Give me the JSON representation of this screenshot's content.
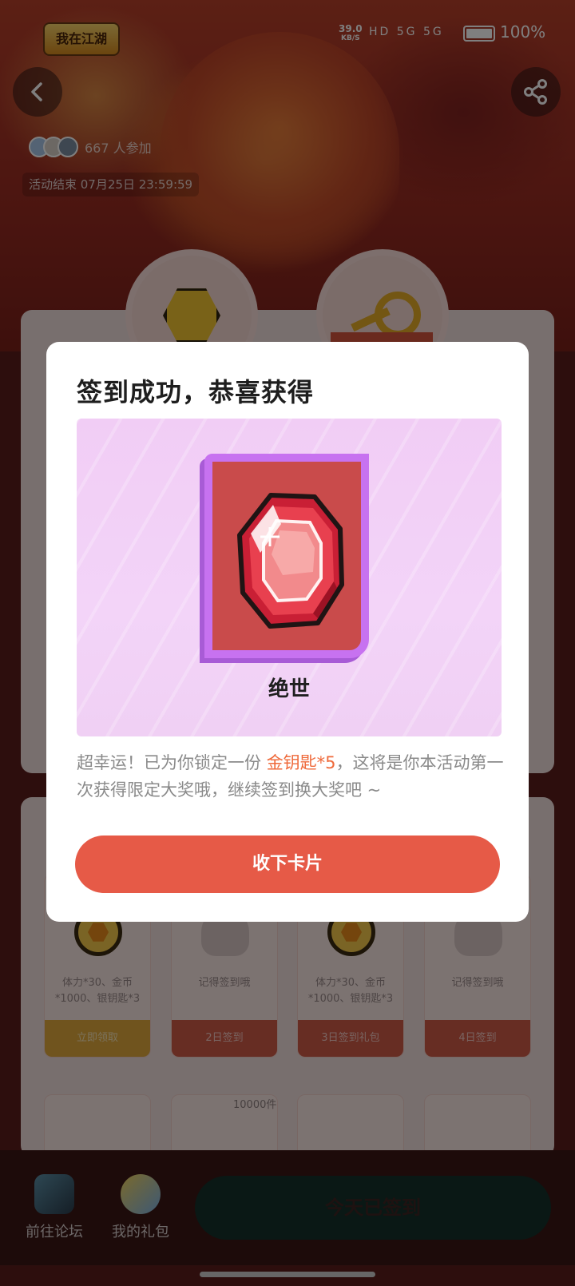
{
  "status_bar": {
    "net_speed": "39.0",
    "net_unit": "KB/S",
    "signal_icons": "HD 5G 5G",
    "battery": "100%"
  },
  "header": {
    "game_logo": "我在江湖",
    "participants": "667 人参加",
    "activity_end": "活动结束 07月25日 23:59:59"
  },
  "rewards_grid": {
    "stock_label": "10000件",
    "cells": [
      {
        "icon": "coin-icon",
        "text": "体力*30、金币*1000、银钥匙*3",
        "footer": "立即领取"
      },
      {
        "icon": "ghost-icon",
        "text": "记得签到哦",
        "footer": "2日签到"
      },
      {
        "icon": "coin-icon",
        "text": "体力*30、金币*1000、银钥匙*3",
        "footer": "3日签到礼包"
      },
      {
        "icon": "ghost-icon",
        "text": "记得签到哦",
        "footer": "4日签到"
      }
    ]
  },
  "bottom_nav": {
    "forum": "前往论坛",
    "gifts": "我的礼包",
    "signed_button": "今天已签到"
  },
  "modal": {
    "title": "签到成功，恭喜获得",
    "card_name": "绝世",
    "desc_prefix": "超幸运！已为你锁定一份 ",
    "desc_highlight": "金钥匙*5",
    "desc_suffix": "，这将是你本活动第一次获得限定大奖哦，继续签到换大奖吧 ~",
    "button": "收下卡片"
  },
  "colors": {
    "accent": "#e65a47",
    "highlight": "#ef6a3b",
    "card_border": "#c772f0",
    "card_bg": "#c94b4b"
  }
}
